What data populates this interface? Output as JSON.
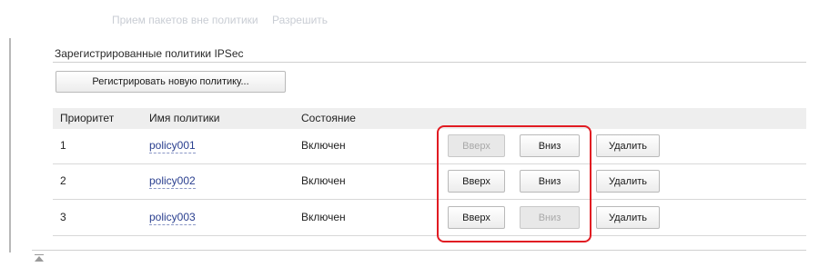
{
  "faded_row": {
    "label": "Прием пакетов вне политики",
    "value": "Разрешить"
  },
  "section": {
    "title": "Зарегистрированные политики IPSec",
    "register_button": "Регистрировать новую политику..."
  },
  "table": {
    "headers": {
      "priority": "Приоритет",
      "name": "Имя политики",
      "status": "Состояние"
    },
    "rows": [
      {
        "priority": "1",
        "name": "policy001",
        "status": "Включен",
        "up_label": "Вверх",
        "up_enabled": false,
        "down_label": "Вниз",
        "down_enabled": true,
        "delete_label": "Удалить"
      },
      {
        "priority": "2",
        "name": "policy002",
        "status": "Включен",
        "up_label": "Вверх",
        "up_enabled": true,
        "down_label": "Вниз",
        "down_enabled": true,
        "delete_label": "Удалить"
      },
      {
        "priority": "3",
        "name": "policy003",
        "status": "Включен",
        "up_label": "Вверх",
        "up_enabled": true,
        "down_label": "Вниз",
        "down_enabled": false,
        "delete_label": "Удалить"
      }
    ]
  },
  "icons": {
    "back_to_top": "back-to-top-icon"
  },
  "colors": {
    "highlight": "#e11b22",
    "link": "#2a3f8f",
    "header_bg": "#eeeeee"
  }
}
